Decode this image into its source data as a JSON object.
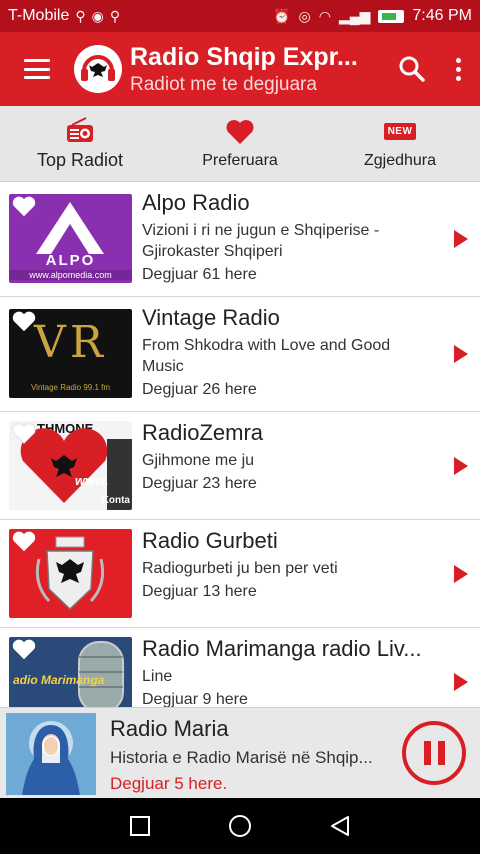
{
  "status_bar": {
    "carrier": "T-Mobile",
    "time": "7:46 PM"
  },
  "app_bar": {
    "title": "Radio Shqip Expr...",
    "subtitle": "Radiot me te degjuara"
  },
  "tabs": [
    {
      "label": "Top Radiot",
      "icon": "radio-icon",
      "active": true
    },
    {
      "label": "Preferuara",
      "icon": "heart-icon",
      "active": false
    },
    {
      "label": "Zgjedhura",
      "icon": "new-badge-icon",
      "badge": "NEW",
      "active": false
    }
  ],
  "stations": [
    {
      "name": "Alpo Radio",
      "description": "Vizioni i ri ne jugun e Shqiperise - Gjirokaster Shqiperi",
      "heard": "Degjuar 61 here",
      "logo_text": "ALPO",
      "logo_url_text": "www.alpomedia.com"
    },
    {
      "name": "Vintage Radio",
      "description": "From Shkodra with Love and Good Music",
      "heard": "Degjuar 26 here",
      "logo_text": "VR",
      "logo_sub_text": "Vintage Radio 99.1 fm"
    },
    {
      "name": "RadioZemra",
      "description": "Gjihmone me ju",
      "heard": "Degjuar 23 here",
      "logo_text": "THMONE",
      "logo_sub_text": "www.",
      "logo_corner_text": "Konta"
    },
    {
      "name": "Radio Gurbeti",
      "description": "Radiogurbeti ju ben per veti",
      "heard": "Degjuar 13 here"
    },
    {
      "name": "Radio Marimanga radio Liv...",
      "description": "Line",
      "heard": "Degjuar 9 here",
      "logo_text": "adio Marimanga"
    }
  ],
  "player": {
    "title": "Radio Maria",
    "description": "Historia e Radio Marisë në Shqip...",
    "heard": "Degjuar 5 here."
  },
  "colors": {
    "accent": "#d81f26",
    "status_bar": "#b3101c"
  }
}
